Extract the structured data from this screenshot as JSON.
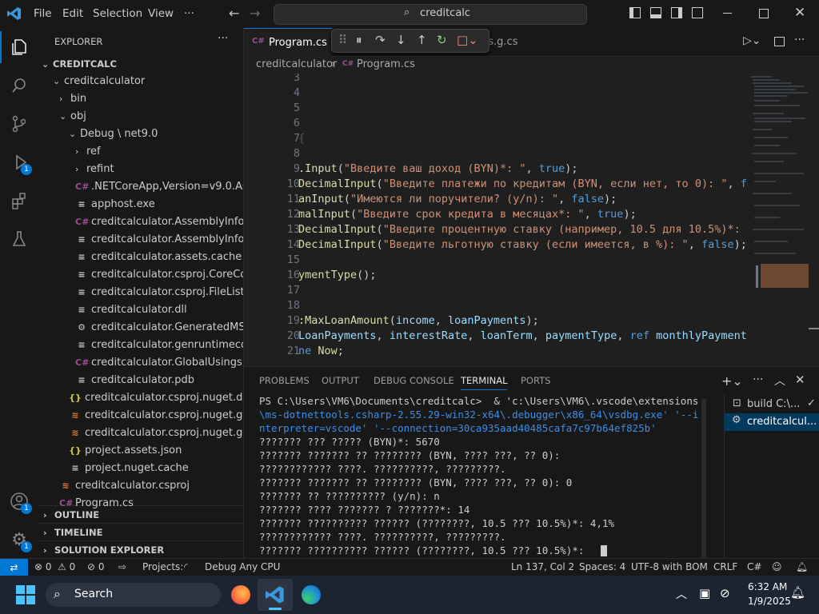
{
  "menu": {
    "file": "File",
    "edit": "Edit",
    "selection": "Selection",
    "view": "View",
    "more": "···"
  },
  "search": {
    "value": "creditcalc"
  },
  "explorer": {
    "title": "EXPLORER",
    "root": "CREDITCALC",
    "items": [
      {
        "label": "creditcalculator",
        "level": 1,
        "chev": "⌄",
        "icon": ""
      },
      {
        "label": "bin",
        "level": 2,
        "chev": "›",
        "icon": ""
      },
      {
        "label": "obj",
        "level": 2,
        "chev": "⌄",
        "icon": ""
      },
      {
        "label": "Debug \\ net9.0",
        "level": 3,
        "chev": "⌄",
        "icon": ""
      },
      {
        "label": "ref",
        "level": 4,
        "chev": "›",
        "icon": ""
      },
      {
        "label": "refint",
        "level": 4,
        "chev": "›",
        "icon": ""
      },
      {
        "label": ".NETCoreApp,Version=v9.0.Asse...",
        "level": 4,
        "chev": "",
        "icon": "C#"
      },
      {
        "label": "apphost.exe",
        "level": 4,
        "chev": "",
        "icon": "≡"
      },
      {
        "label": "creditcalculator.AssemblyInfo.cs",
        "level": 4,
        "chev": "",
        "icon": "C#"
      },
      {
        "label": "creditcalculator.AssemblyInfoInp...",
        "level": 4,
        "chev": "",
        "icon": "≡"
      },
      {
        "label": "creditcalculator.assets.cache",
        "level": 4,
        "chev": "",
        "icon": "≡"
      },
      {
        "label": "creditcalculator.csproj.CoreCom...",
        "level": 4,
        "chev": "",
        "icon": "≡"
      },
      {
        "label": "creditcalculator.csproj.FileListAb...",
        "level": 4,
        "chev": "",
        "icon": "≡"
      },
      {
        "label": "creditcalculator.dll",
        "level": 4,
        "chev": "",
        "icon": "≡"
      },
      {
        "label": "creditcalculator.GeneratedMSBui...",
        "level": 4,
        "chev": "",
        "icon": "⚙"
      },
      {
        "label": "creditcalculator.genruntimeconfi...",
        "level": 4,
        "chev": "",
        "icon": "≡"
      },
      {
        "label": "creditcalculator.GlobalUsings.g.cs",
        "level": 4,
        "chev": "",
        "icon": "C#"
      },
      {
        "label": "creditcalculator.pdb",
        "level": 4,
        "chev": "",
        "icon": "≡"
      },
      {
        "label": "creditcalculator.csproj.nuget.dgsp...",
        "level": 3,
        "chev": "",
        "icon": "{}"
      },
      {
        "label": "creditcalculator.csproj.nuget.g.pro...",
        "level": 3,
        "chev": "",
        "icon": "ʀss"
      },
      {
        "label": "creditcalculator.csproj.nuget.g.tar...",
        "level": 3,
        "chev": "",
        "icon": "ʀss"
      },
      {
        "label": "project.assets.json",
        "level": 3,
        "chev": "",
        "icon": "{}"
      },
      {
        "label": "project.nuget.cache",
        "level": 3,
        "chev": "",
        "icon": "≡"
      },
      {
        "label": "creditcalculator.csproj",
        "level": 2,
        "chev": "",
        "icon": "ʀss"
      },
      {
        "label": "Program.cs",
        "level": 2,
        "chev": "",
        "icon": "C#"
      }
    ],
    "sections": [
      "OUTLINE",
      "TIMELINE",
      "SOLUTION EXPLORER"
    ]
  },
  "tabs": {
    "active": "Program.cs",
    "second": "gs.g.cs"
  },
  "breadcrumb": {
    "folder": "creditcalculator",
    "file": "Program.cs"
  },
  "code": {
    "lines": [
      {
        "n": "3",
        "html": ""
      },
      {
        "n": "4",
        "html": ""
      },
      {
        "n": "5",
        "html": ""
      },
      {
        "n": "6",
        "html": ""
      },
      {
        "n": "7",
        "html": "<span style='color:#555'>{</span>"
      },
      {
        "n": "8",
        "html": ""
      },
      {
        "n": "9",
        "html": "<span class='f'>.Input</span>(<span class='s'>\"Введите ваш доход (BYN)*: \"</span>, <span class='k'>true</span>);"
      },
      {
        "n": "10",
        "html": "<span class='f'>DecimalInput</span>(<span class='s'>\"Введите платежи по кредитам (BYN, если нет, то 0): \"</span>, <span class='k'>false</span>"
      },
      {
        "n": "11",
        "html": "<span class='f'>anInput</span>(<span class='s'>\"Имеются ли поручители? (y/n): \"</span>, <span class='k'>false</span>);"
      },
      {
        "n": "12",
        "html": "<span class='f'>malInput</span>(<span class='s'>\"Введите срок кредита в месяцах*: \"</span>, <span class='k'>true</span>);"
      },
      {
        "n": "13",
        "html": "<span class='f'>DecimalInput</span>(<span class='s'>\"Введите процентную ставку (например, 10.5 для 10.5%)*: \"</span>, <span class='k'>t</span>"
      },
      {
        "n": "14",
        "html": "<span class='f'>DecimalInput</span>(<span class='s'>\"Введите льготную ставку (если имеется, в %): \"</span>, <span class='k'>false</span>);"
      },
      {
        "n": "15",
        "html": ""
      },
      {
        "n": "16",
        "html": "<span class='f'>ymentType</span>();"
      },
      {
        "n": "17",
        "html": ""
      },
      {
        "n": "18",
        "html": ""
      },
      {
        "n": "19",
        "html": "<span class='f'>:MaxLoanAmount</span>(<span class='v'>income</span>, <span class='v'>loanPayments</span>);"
      },
      {
        "n": "20",
        "html": "<span class='v'>LoanPayments</span>, <span class='v'>interestRate</span>, <span class='v'>loanTerm</span>, <span class='v'>paymentType</span>, <span class='k'>ref</span> <span class='v'>monthlyPayment</span>);"
      },
      {
        "n": "21",
        "html": "<span class='k'>ne</span> <span class='f'>Now</span>;"
      }
    ]
  },
  "panel": {
    "tabs": [
      "PROBLEMS",
      "OUTPUT",
      "DEBUG CONSOLE",
      "TERMINAL",
      "PORTS"
    ],
    "active": "TERMINAL",
    "terminal_lines": [
      "PS C:\\Users\\VM6\\Documents\\creditcalc>  & 'c:\\Users\\VM6\\.vscode\\extensions",
      "\\ms-dotnettools.csharp-2.55.29-win32-x64\\.debugger\\x86_64\\vsdbg.exe' '--i",
      "nterpreter=vscode' '--connection=30ca935aad40485cafa7c97b64ef825b'",
      "??????? ??? ????? (BYN)*: 5670",
      "??????? ??????? ?? ???????? (BYN, ???? ???, ?? 0):",
      "???????????? ????. ??????????, ?????????.",
      "??????? ??????? ?? ???????? (BYN, ???? ???, ?? 0): 0",
      "??????? ?? ?????????? (y/n): n",
      "??????? ???? ??????? ? ???????*: 14",
      "??????? ?????????? ?????? (????????, 10.5 ??? 10.5%)*: 4,1%",
      "???????????? ????. ??????????, ?????????.",
      "??????? ?????????? ?????? (????????, 10.5 ??? 10.5%)*: "
    ],
    "terminals": [
      "build C:\\...",
      "creditcalcul..."
    ]
  },
  "status": {
    "errors": "0",
    "warnings": "0",
    "ports": "0",
    "projects": "Projects:",
    "config": "Debug Any CPU",
    "position": "Ln 137, Col 2",
    "spaces": "Spaces: 4",
    "encoding": "UTF-8 with BOM",
    "eol": "CRLF",
    "lang": "C#"
  },
  "taskbar": {
    "search": "Search",
    "time": "6:32 AM",
    "date": "1/9/2025"
  },
  "colors": {
    "accent": "#0078d4",
    "bg": "#1f1f1f"
  }
}
